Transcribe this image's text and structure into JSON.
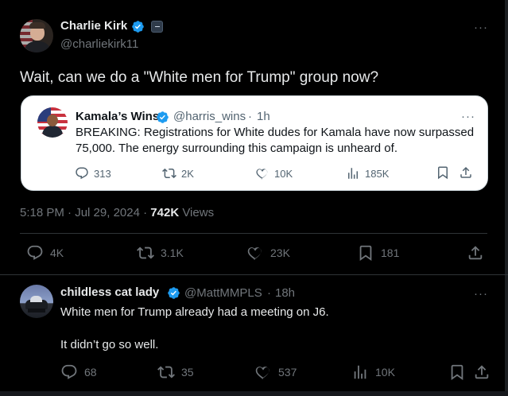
{
  "post": {
    "author_name": "Charlie Kirk",
    "handle": "@charliekirk11",
    "text": "Wait, can we do a \"White men for Trump\" group now?",
    "more_label": "···",
    "time": "5:18 PM",
    "date": "Jul 29, 2024",
    "separator": "·",
    "views_count": "742K",
    "views_label": "Views",
    "stats": {
      "replies": "4K",
      "reposts": "3.1K",
      "likes": "23K",
      "bookmarks": "181"
    }
  },
  "quote": {
    "author_name": "Kamala’s Wins",
    "handle": "@harris_wins",
    "separator": "·",
    "age": "1h",
    "more_label": "···",
    "text": "BREAKING: Registrations for White dudes for Kamala have now surpassed 75,000. The energy surrounding this campaign is unheard of.",
    "stats": {
      "replies": "313",
      "reposts": "2K",
      "likes": "10K",
      "views": "185K"
    }
  },
  "reply": {
    "author_name": "childless cat lady",
    "handle": "@MattMMPLS",
    "separator": "·",
    "age": "18h",
    "more_label": "···",
    "line1": "White men for Trump already had a meeting on J6.",
    "line2": "It didn’t go so well.",
    "stats": {
      "replies": "68",
      "reposts": "35",
      "likes": "537",
      "views": "10K"
    }
  },
  "colors": {
    "background": "#000000",
    "text_primary": "#e7e9ea",
    "text_secondary": "#71767b",
    "verified_blue": "#1d9bf0",
    "quote_background": "#ffffff",
    "divider": "#2f3336"
  },
  "icons": [
    "verified-icon",
    "affiliation-badge-icon",
    "reply-icon",
    "repost-icon",
    "like-icon",
    "views-icon",
    "bookmark-icon",
    "share-icon",
    "more-icon"
  ]
}
